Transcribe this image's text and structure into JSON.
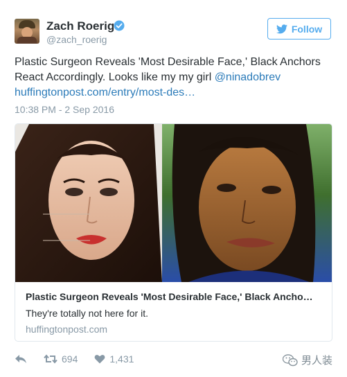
{
  "user": {
    "display_name": "Zach Roerig",
    "handle": "@zach_roerig",
    "verified": true
  },
  "follow_button": {
    "label": "Follow",
    "icon": "twitter-bird-icon"
  },
  "tweet": {
    "text_part1": "Plastic Surgeon Reveals 'Most Desirable Face,' Black Anchors React Accordingly. Looks like my my girl ",
    "mention": "@ninadobrev",
    "link": "huffingtonpost.com/entry/most-des…",
    "timestamp": "10:38 PM - 2 Sep 2016"
  },
  "card": {
    "title": "Plastic Surgeon Reveals 'Most Desirable Face,' Black Ancho…",
    "description": "They're totally not here for it.",
    "domain": "huffingtonpost.com"
  },
  "actions": {
    "reply_icon": "reply-icon",
    "retweet_icon": "retweet-icon",
    "retweet_count": "694",
    "like_icon": "heart-icon",
    "like_count": "1,431"
  },
  "watermark": {
    "text": "男人装",
    "icon": "wechat-icon"
  },
  "colors": {
    "accent": "#55acee",
    "link": "#2b7bb9",
    "muted": "#8899a6",
    "text": "#292f33",
    "border": "#e1e8ed"
  }
}
